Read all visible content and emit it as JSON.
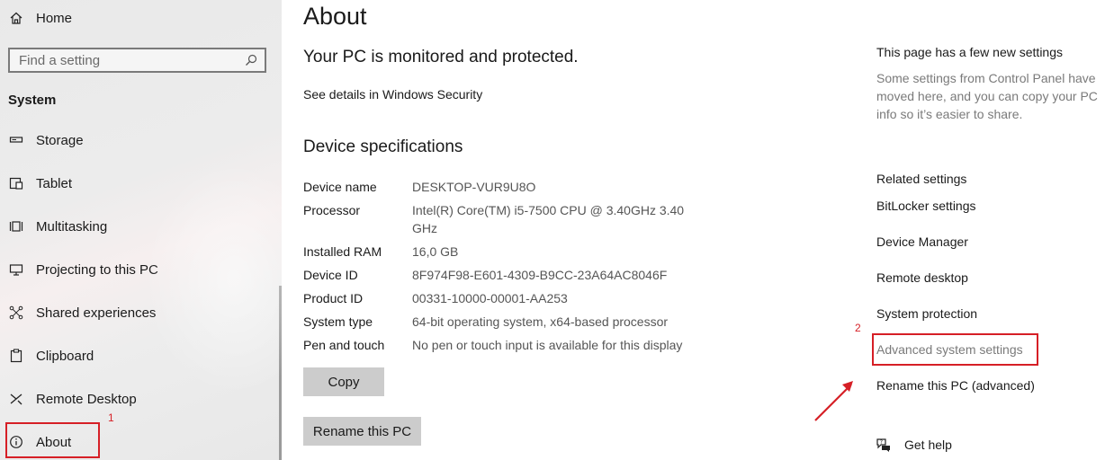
{
  "sidebar": {
    "home_label": "Home",
    "search_placeholder": "Find a setting",
    "section_label": "System",
    "items": [
      {
        "label": "Storage",
        "icon": "storage-icon"
      },
      {
        "label": "Tablet",
        "icon": "tablet-icon"
      },
      {
        "label": "Multitasking",
        "icon": "multitasking-icon"
      },
      {
        "label": "Projecting to this PC",
        "icon": "projecting-icon"
      },
      {
        "label": "Shared experiences",
        "icon": "shared-experiences-icon"
      },
      {
        "label": "Clipboard",
        "icon": "clipboard-icon"
      },
      {
        "label": "Remote Desktop",
        "icon": "remote-desktop-icon"
      },
      {
        "label": "About",
        "icon": "info-icon"
      }
    ],
    "annotation_1": "1"
  },
  "main": {
    "title": "About",
    "protected_heading": "Your PC is monitored and protected.",
    "security_link": "See details in Windows Security",
    "specs_heading": "Device specifications",
    "specs": [
      {
        "label": "Device name",
        "value": "DESKTOP-VUR9U8O"
      },
      {
        "label": "Processor",
        "value": "Intel(R) Core(TM) i5-7500 CPU @ 3.40GHz   3.40 GHz"
      },
      {
        "label": "Installed RAM",
        "value": "16,0 GB"
      },
      {
        "label": "Device ID",
        "value": "8F974F98-E601-4309-B9CC-23A64AC8046F"
      },
      {
        "label": "Product ID",
        "value": "00331-10000-00001-AA253"
      },
      {
        "label": "System type",
        "value": "64-bit operating system, x64-based processor"
      },
      {
        "label": "Pen and touch",
        "value": "No pen or touch input is available for this display"
      }
    ],
    "copy_button": "Copy",
    "rename_button": "Rename this PC"
  },
  "right": {
    "new_settings_title": "This page has a few new settings",
    "new_settings_desc": "Some settings from Control Panel have moved here, and you can copy your PC info so it’s easier to share.",
    "related_title": "Related settings",
    "links": [
      "BitLocker settings",
      "Device Manager",
      "Remote desktop",
      "System protection",
      "Advanced system settings",
      "Rename this PC (advanced)"
    ],
    "get_help": "Get help",
    "annotation_2": "2"
  },
  "colors": {
    "annotation_red": "#d61f26",
    "sidebar_bg": "#e9e9e9",
    "button_bg": "#cccccc"
  }
}
